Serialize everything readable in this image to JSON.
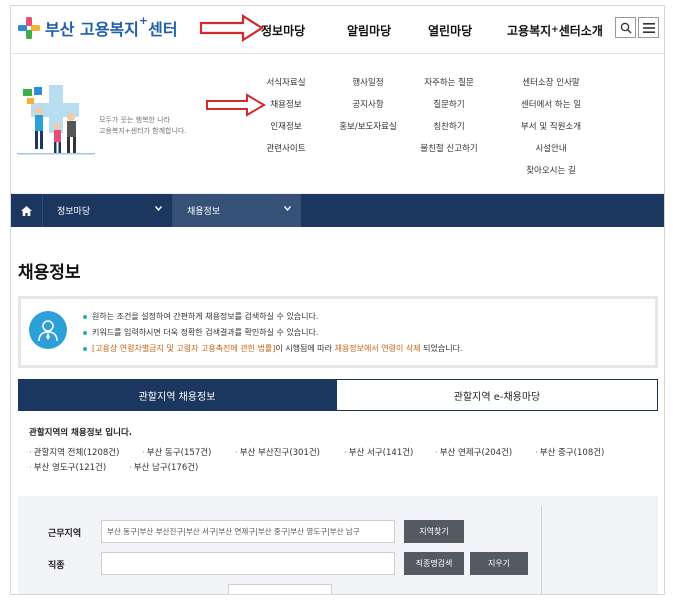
{
  "header": {
    "logo_text": "부산 고용복지",
    "logo_plus": "+",
    "logo_suffix": "센터",
    "nav": [
      {
        "label": "정보마당"
      },
      {
        "label": "알림마당"
      },
      {
        "label": "열린마당"
      },
      {
        "label_pre": "고용복지",
        "label_sup": "+",
        "label_post": "센터소개"
      }
    ]
  },
  "mega": {
    "slogan_line1": "모두가 웃는 행복한 나라",
    "slogan_line2": "고용복지+센터가 함께합니다.",
    "col1": [
      "서식자료실",
      "채용정보",
      "인재정보",
      "관련사이트"
    ],
    "col2": [
      "행사일정",
      "공지사항",
      "홍보/보도자료실"
    ],
    "col3": [
      "자주하는 질문",
      "질문하기",
      "칭찬하기",
      "불친절 신고하기"
    ],
    "col4": [
      "센터소장 인사말",
      "센터에서 하는 일",
      "부서 및 직원소개",
      "시설안내",
      "찾아오시는 길"
    ]
  },
  "breadcrumb": {
    "level1": "정보마당",
    "level2": "채용정보"
  },
  "page": {
    "title": "채용정보"
  },
  "info": {
    "line1": "원하는 조건을 설정하여 간편하게 채용정보를 검색하실 수 있습니다.",
    "line2": "키워드를 입력하시면 더욱 정확한 검색결과를 확인하실 수 있습니다.",
    "line3_a": "[고용상 연령차별금지 및 고령자 고용촉진에 관한 법률]",
    "line3_b": "이 시행됨에 따라 ",
    "line3_c": "채용정보에서 연령이 삭제",
    "line3_d": " 되었습니다."
  },
  "tabs": {
    "active": "관할지역 채용정보",
    "inactive": "관할지역 e-채용마당"
  },
  "regions": {
    "title": "관할지역의 채용정보 입니다.",
    "items": [
      "관할지역 전체(1208건)",
      "부산 동구(157건)",
      "부산 부산진구(301건)",
      "부산 서구(141건)",
      "부산 연제구(204건)",
      "부산 중구(108건)",
      "부산 영도구(121건)",
      "부산 남구(176건)"
    ]
  },
  "form": {
    "area_label": "근무지역",
    "area_value": "부산 동구|부산 부산진구|부산 서구|부산 연제구|부산 중구|부산 영도구|부산 남구",
    "area_button": "지역찾기",
    "job_label": "직종",
    "job_value": "",
    "job_button": "직종명검색",
    "clear_button": "지우기"
  },
  "colors": {
    "navy": "#1b3760",
    "logo_blue": "#1f5ea8",
    "accent_orange": "#c86414",
    "arrow_red": "#d22a2a",
    "bullet_teal": "#2bb0a3"
  }
}
